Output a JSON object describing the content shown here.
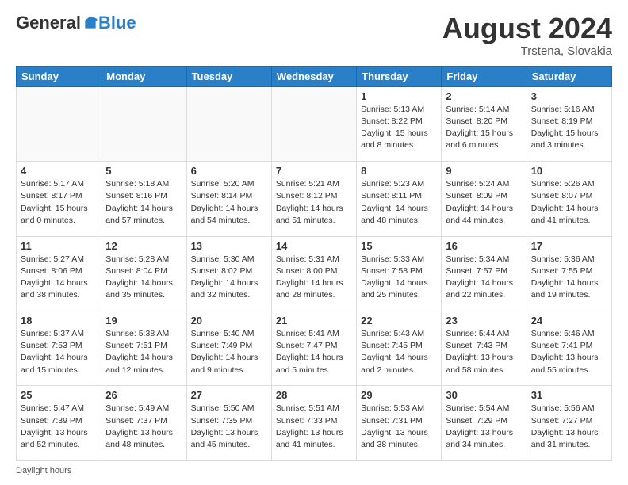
{
  "header": {
    "logo_general": "General",
    "logo_blue": "Blue",
    "month_title": "August 2024",
    "location": "Trstena, Slovakia"
  },
  "days_of_week": [
    "Sunday",
    "Monday",
    "Tuesday",
    "Wednesday",
    "Thursday",
    "Friday",
    "Saturday"
  ],
  "weeks": [
    [
      {
        "day": "",
        "empty": true
      },
      {
        "day": "",
        "empty": true
      },
      {
        "day": "",
        "empty": true
      },
      {
        "day": "",
        "empty": true
      },
      {
        "day": "1",
        "sunrise": "5:13 AM",
        "sunset": "8:22 PM",
        "daylight": "15 hours and 8 minutes."
      },
      {
        "day": "2",
        "sunrise": "5:14 AM",
        "sunset": "8:20 PM",
        "daylight": "15 hours and 6 minutes."
      },
      {
        "day": "3",
        "sunrise": "5:16 AM",
        "sunset": "8:19 PM",
        "daylight": "15 hours and 3 minutes."
      }
    ],
    [
      {
        "day": "4",
        "sunrise": "5:17 AM",
        "sunset": "8:17 PM",
        "daylight": "15 hours and 0 minutes."
      },
      {
        "day": "5",
        "sunrise": "5:18 AM",
        "sunset": "8:16 PM",
        "daylight": "14 hours and 57 minutes."
      },
      {
        "day": "6",
        "sunrise": "5:20 AM",
        "sunset": "8:14 PM",
        "daylight": "14 hours and 54 minutes."
      },
      {
        "day": "7",
        "sunrise": "5:21 AM",
        "sunset": "8:12 PM",
        "daylight": "14 hours and 51 minutes."
      },
      {
        "day": "8",
        "sunrise": "5:23 AM",
        "sunset": "8:11 PM",
        "daylight": "14 hours and 48 minutes."
      },
      {
        "day": "9",
        "sunrise": "5:24 AM",
        "sunset": "8:09 PM",
        "daylight": "14 hours and 44 minutes."
      },
      {
        "day": "10",
        "sunrise": "5:26 AM",
        "sunset": "8:07 PM",
        "daylight": "14 hours and 41 minutes."
      }
    ],
    [
      {
        "day": "11",
        "sunrise": "5:27 AM",
        "sunset": "8:06 PM",
        "daylight": "14 hours and 38 minutes."
      },
      {
        "day": "12",
        "sunrise": "5:28 AM",
        "sunset": "8:04 PM",
        "daylight": "14 hours and 35 minutes."
      },
      {
        "day": "13",
        "sunrise": "5:30 AM",
        "sunset": "8:02 PM",
        "daylight": "14 hours and 32 minutes."
      },
      {
        "day": "14",
        "sunrise": "5:31 AM",
        "sunset": "8:00 PM",
        "daylight": "14 hours and 28 minutes."
      },
      {
        "day": "15",
        "sunrise": "5:33 AM",
        "sunset": "7:58 PM",
        "daylight": "14 hours and 25 minutes."
      },
      {
        "day": "16",
        "sunrise": "5:34 AM",
        "sunset": "7:57 PM",
        "daylight": "14 hours and 22 minutes."
      },
      {
        "day": "17",
        "sunrise": "5:36 AM",
        "sunset": "7:55 PM",
        "daylight": "14 hours and 19 minutes."
      }
    ],
    [
      {
        "day": "18",
        "sunrise": "5:37 AM",
        "sunset": "7:53 PM",
        "daylight": "14 hours and 15 minutes."
      },
      {
        "day": "19",
        "sunrise": "5:38 AM",
        "sunset": "7:51 PM",
        "daylight": "14 hours and 12 minutes."
      },
      {
        "day": "20",
        "sunrise": "5:40 AM",
        "sunset": "7:49 PM",
        "daylight": "14 hours and 9 minutes."
      },
      {
        "day": "21",
        "sunrise": "5:41 AM",
        "sunset": "7:47 PM",
        "daylight": "14 hours and 5 minutes."
      },
      {
        "day": "22",
        "sunrise": "5:43 AM",
        "sunset": "7:45 PM",
        "daylight": "14 hours and 2 minutes."
      },
      {
        "day": "23",
        "sunrise": "5:44 AM",
        "sunset": "7:43 PM",
        "daylight": "13 hours and 58 minutes."
      },
      {
        "day": "24",
        "sunrise": "5:46 AM",
        "sunset": "7:41 PM",
        "daylight": "13 hours and 55 minutes."
      }
    ],
    [
      {
        "day": "25",
        "sunrise": "5:47 AM",
        "sunset": "7:39 PM",
        "daylight": "13 hours and 52 minutes."
      },
      {
        "day": "26",
        "sunrise": "5:49 AM",
        "sunset": "7:37 PM",
        "daylight": "13 hours and 48 minutes."
      },
      {
        "day": "27",
        "sunrise": "5:50 AM",
        "sunset": "7:35 PM",
        "daylight": "13 hours and 45 minutes."
      },
      {
        "day": "28",
        "sunrise": "5:51 AM",
        "sunset": "7:33 PM",
        "daylight": "13 hours and 41 minutes."
      },
      {
        "day": "29",
        "sunrise": "5:53 AM",
        "sunset": "7:31 PM",
        "daylight": "13 hours and 38 minutes."
      },
      {
        "day": "30",
        "sunrise": "5:54 AM",
        "sunset": "7:29 PM",
        "daylight": "13 hours and 34 minutes."
      },
      {
        "day": "31",
        "sunrise": "5:56 AM",
        "sunset": "7:27 PM",
        "daylight": "13 hours and 31 minutes."
      }
    ]
  ],
  "footer": {
    "note": "Daylight hours"
  }
}
